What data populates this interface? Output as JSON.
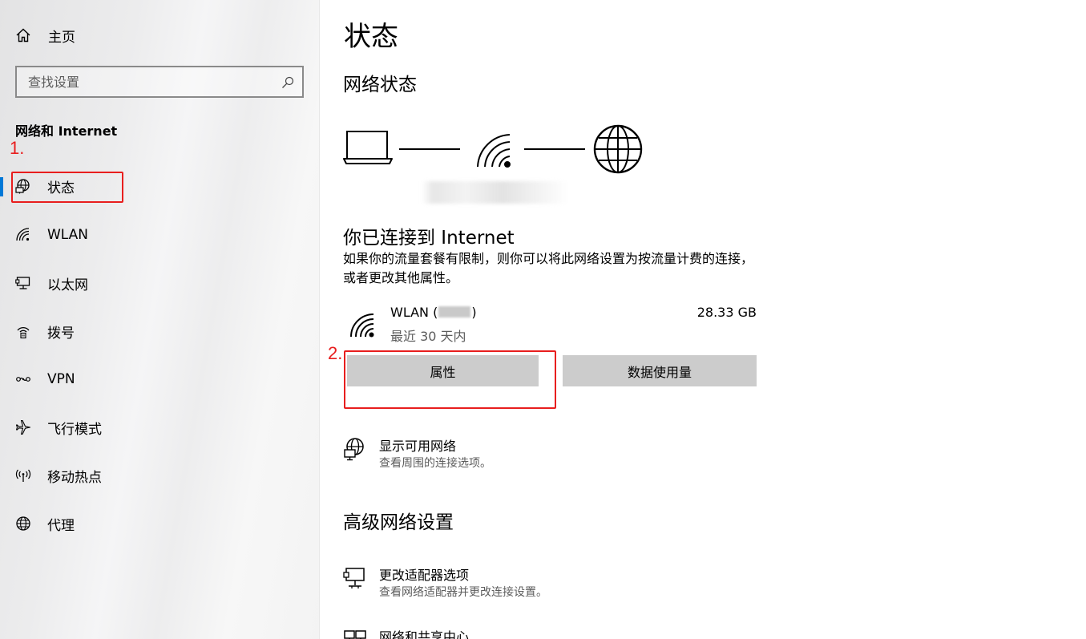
{
  "sidebar": {
    "home_label": "主页",
    "search_placeholder": "查找设置",
    "section_title": "网络和 Internet",
    "items": [
      {
        "label": "状态",
        "icon": "globe-status-icon",
        "selected": true
      },
      {
        "label": "WLAN",
        "icon": "wifi-icon"
      },
      {
        "label": "以太网",
        "icon": "ethernet-icon"
      },
      {
        "label": "拨号",
        "icon": "dialup-icon"
      },
      {
        "label": "VPN",
        "icon": "vpn-icon"
      },
      {
        "label": "飞行模式",
        "icon": "airplane-icon"
      },
      {
        "label": "移动热点",
        "icon": "hotspot-icon"
      },
      {
        "label": "代理",
        "icon": "globe-icon"
      }
    ]
  },
  "main": {
    "title": "状态",
    "network_status_heading": "网络状态",
    "connected_title": "你已连接到 Internet",
    "connected_desc": "如果你的流量套餐有限制，则你可以将此网络设置为按流量计费的连接，或者更改其他属性。",
    "adapter": {
      "name_prefix": "WLAN (",
      "name_suffix": ")",
      "period": "最近 30 天内",
      "usage": "28.33 GB"
    },
    "buttons": {
      "properties": "属性",
      "data_usage": "数据使用量"
    },
    "show_networks": {
      "title": "显示可用网络",
      "subtitle": "查看周围的连接选项。"
    },
    "advanced_heading": "高级网络设置",
    "change_adapter": {
      "title": "更改适配器选项",
      "subtitle": "查看网络适配器并更改连接设置。"
    },
    "sharing_center": {
      "title": "网络和共享中心"
    }
  },
  "annotations": {
    "step1": "1.",
    "step2": "2.",
    "color": "#e81e1e"
  },
  "colors": {
    "accent": "#0078d7",
    "button_bg": "#cccccc"
  }
}
